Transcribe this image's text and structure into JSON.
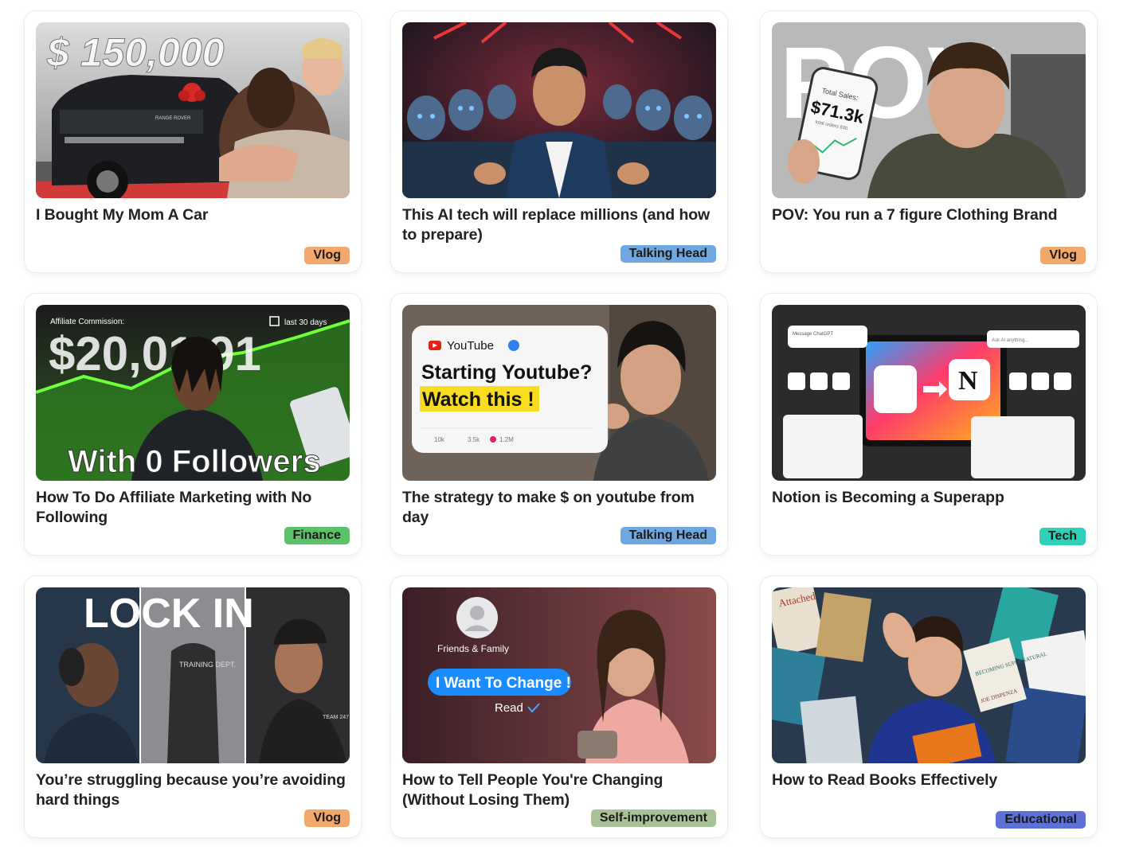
{
  "cards": [
    {
      "title": "I Bought My Mom A Car",
      "tag": "Vlog",
      "tag_color": "#f2a86b",
      "thumb": {
        "big_text": "$ 150,000",
        "plate_text": "RANGE ROVER"
      }
    },
    {
      "title": "This AI tech will replace millions (and how to prepare)",
      "tag": "Talking Head",
      "tag_color": "#6fa7e0"
    },
    {
      "title": "POV: You run a 7 figure Clothing Brand",
      "tag": "Vlog",
      "tag_color": "#f2a86b",
      "thumb": {
        "big_text": "POV",
        "phone_label": "Total Sales:",
        "phone_value": "$71.3k",
        "phone_sub": "total orders 830"
      }
    },
    {
      "title": "How To Do Affiliate Marketing with No Following",
      "tag": "Finance",
      "tag_color": "#5cc26a",
      "thumb": {
        "top_label": "Affiliate Commission:",
        "period": "last 30 days",
        "big_text": "$20,01.91",
        "bottom_text": "With 0 Followers"
      }
    },
    {
      "title": "The strategy to make $ on youtube from day",
      "tag": "Talking Head",
      "tag_color": "#6fa7e0",
      "thumb": {
        "channel": "YouTube",
        "line1": "Starting Youtube?",
        "line2": "Watch this !",
        "stat1": "10k",
        "stat2": "3.5k",
        "stat3": "1.2M"
      }
    },
    {
      "title": "Notion is Becoming a Superapp",
      "tag": "Tech",
      "tag_color": "#2fcfb8",
      "thumb": {
        "prompt1": "Message ChatGPT",
        "prompt2": "Ask AI anything..."
      }
    },
    {
      "title": "You’re struggling because you’re avoiding hard things",
      "tag": "Vlog",
      "tag_color": "#f2a86b",
      "thumb": {
        "big_text": "LOCK IN",
        "shirt1": "TRAINING DEPT.",
        "shirt2": "TEAM 247"
      }
    },
    {
      "title": "How to Tell People You're Changing (Without Losing Them)",
      "tag": "Self-improvement",
      "tag_color": "#a8c196",
      "thumb": {
        "contact": "Friends & Family",
        "message": "I Want To Change !",
        "status": "Read"
      }
    },
    {
      "title": "How to Read Books Effectively",
      "tag": "Educational",
      "tag_color": "#5d71d9",
      "thumb": {
        "book1": "Attached",
        "book2": "BECOMING SUPERNATURAL",
        "book3": "JOE DISPENZA"
      }
    }
  ]
}
